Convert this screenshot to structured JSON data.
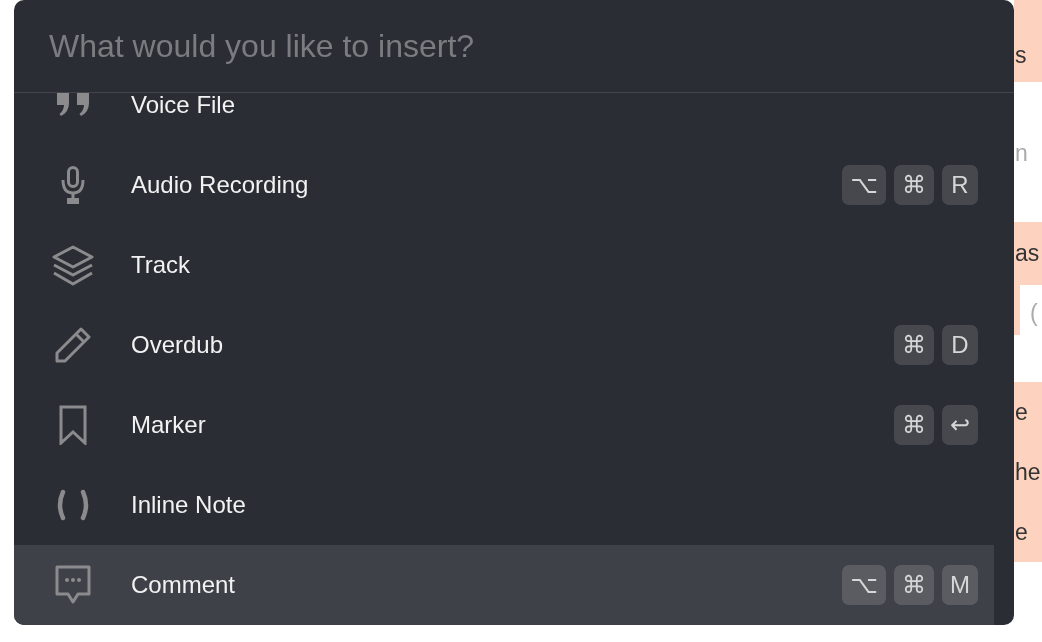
{
  "search": {
    "placeholder": "What would you like to insert?"
  },
  "items": [
    {
      "label": "Voice File",
      "selected": false
    },
    {
      "label": "Audio Recording",
      "shortcut": [
        "⌥",
        "⌘",
        "R"
      ],
      "selected": false
    },
    {
      "label": "Track",
      "selected": false
    },
    {
      "label": "Overdub",
      "shortcut": [
        "⌘",
        "D"
      ],
      "selected": false
    },
    {
      "label": "Marker",
      "shortcut": [
        "⌘",
        "↩"
      ],
      "selected": false
    },
    {
      "label": "Inline Note",
      "selected": false
    },
    {
      "label": "Comment",
      "shortcut": [
        "⌥",
        "⌘",
        "M"
      ],
      "selected": true
    }
  ],
  "background_document": {
    "blocks": [
      {
        "highlighted": true,
        "lines": [
          "s"
        ]
      },
      {
        "highlighted": false,
        "lines": [
          "n"
        ]
      },
      {
        "highlighted": true,
        "lines": [
          "as"
        ],
        "inset_text": "("
      },
      {
        "highlighted": true,
        "lines": [
          "e",
          "he",
          "e"
        ]
      }
    ]
  }
}
